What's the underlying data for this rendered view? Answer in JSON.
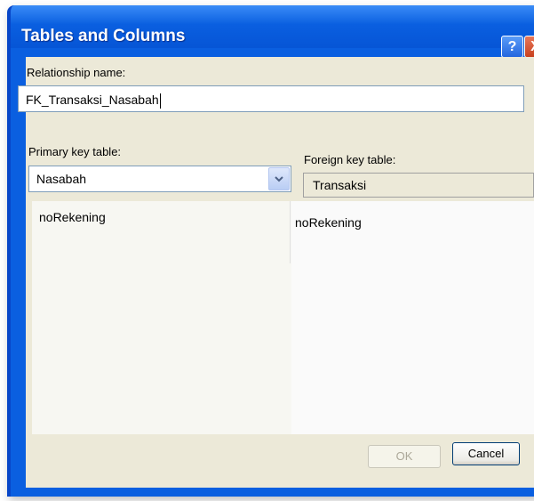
{
  "window": {
    "title": "Tables and Columns",
    "help_label": "?",
    "close_label": "X"
  },
  "form": {
    "relationship_label": "Relationship name:",
    "relationship_value": "FK_Transaksi_Nasabah",
    "primary_key_label": "Primary key table:",
    "primary_key_value": "Nasabah",
    "foreign_key_label": "Foreign key table:",
    "foreign_key_value": "Transaksi"
  },
  "columns": {
    "primary": [
      "noRekening"
    ],
    "foreign": [
      "noRekening"
    ]
  },
  "buttons": {
    "ok": "OK",
    "cancel": "Cancel"
  },
  "colors": {
    "titlebar": "#0a5fe0",
    "dialog_bg": "#ece9d8",
    "close": "#c8401e"
  }
}
